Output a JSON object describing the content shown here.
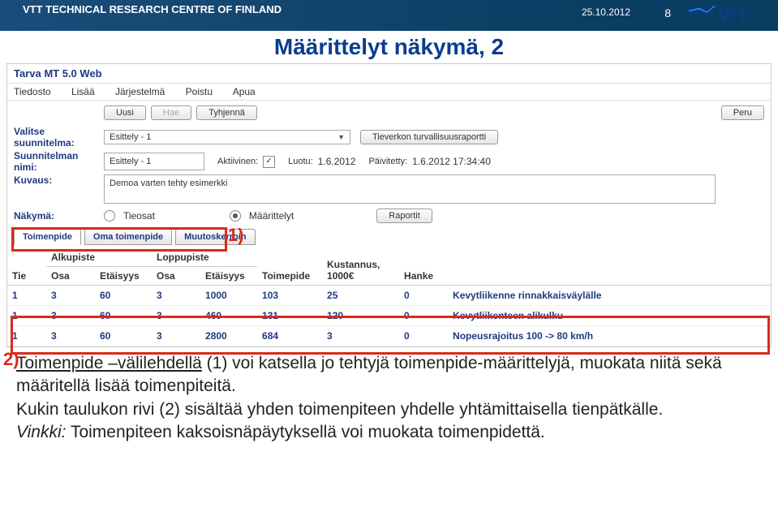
{
  "header": {
    "org": "VTT TECHNICAL RESEARCH CENTRE OF FINLAND",
    "date": "25.10.2012",
    "page": "8"
  },
  "slide_title": "Määrittelyt näkymä, 2",
  "app": {
    "title": "Tarva MT 5.0 Web",
    "menu": [
      "Tiedosto",
      "Lisää",
      "Järjestelmä",
      "Poistu",
      "Apua"
    ],
    "toolbar": {
      "uusi": "Uusi",
      "hae": "Hae",
      "tyhjenna": "Tyhjennä",
      "peru": "Peru"
    },
    "form": {
      "valitse_lbl": "Valitse suunnitelma:",
      "valitse_value": "Esittely - 1",
      "report_lbl": "Tieverkon turvallisuusraportti",
      "nimi_lbl": "Suunnitelman nimi:",
      "nimi_value": "Esittely - 1",
      "aktiivinen_lbl": "Aktiivinen:",
      "luotu_lbl": "Luotu:",
      "luotu_val": "1.6.2012",
      "paiv_lbl": "Päivitetty:",
      "paiv_val": "1.6.2012 17:34:40",
      "kuvaus_lbl": "Kuvaus:",
      "kuvaus_val": "Demoa varten tehty esimerkki",
      "nakyma_lbl": "Näkymä:",
      "opt_tieosat": "Tieosat",
      "opt_maar": "Määrittelyt",
      "raportit": "Raportit"
    },
    "tabs": [
      "Toimenpide",
      "Oma toimenpide",
      "Muutoskerroin"
    ],
    "callout1": "1)",
    "table": {
      "headers": {
        "tie": "Tie",
        "alku": "Alkupiste",
        "loppu": "Loppupiste",
        "osa": "Osa",
        "etaisyys": "Etäisyys",
        "toimepide": "Toimepide",
        "kustannus": "Kustannus, 1000€",
        "hanke": "Hanke"
      },
      "rows": [
        {
          "tie": "1",
          "aosa": "3",
          "aet": "60",
          "losa": "3",
          "let": "1000",
          "toim": "103",
          "kust": "25",
          "hanke": "0",
          "desc": "Kevytliikenne rinnakkaisväylälle"
        },
        {
          "tie": "1",
          "aosa": "3",
          "aet": "60",
          "losa": "3",
          "let": "460",
          "toim": "131",
          "kust": "120",
          "hanke": "0",
          "desc": "Kevytliikenteen alikulku"
        },
        {
          "tie": "1",
          "aosa": "3",
          "aet": "60",
          "losa": "3",
          "let": "2800",
          "toim": "684",
          "kust": "3",
          "hanke": "0",
          "desc": "Nopeusrajoitus 100 -> 80 km/h"
        }
      ]
    },
    "callout2": "2)"
  },
  "paragraphs": {
    "p1a": "Toimenpide –välilehdellä",
    "p1b": " (1)  voi katsella jo tehtyjä toimenpide-määrittelyjä, muokata niitä sekä määritellä lisää toimenpiteitä.",
    "p2": "Kukin taulukon rivi (2) sisältää yhden toimenpiteen yhdelle yhtämittaisella tienpätkälle.",
    "p3a": "Vinkki:",
    "p3b": " Toimenpiteen kaksoisnäpäytyksellä voi muokata toimenpidettä."
  }
}
